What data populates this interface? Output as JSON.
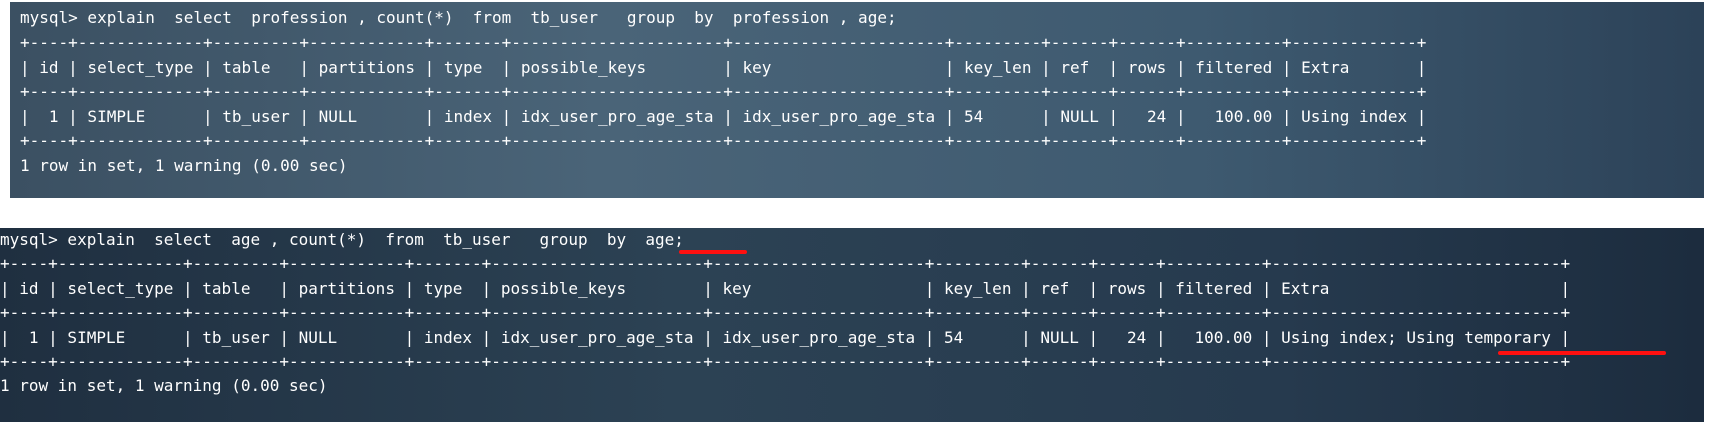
{
  "panel_1": {
    "command": "mysql> explain  select  profession , count(*)  from  tb_user   group  by  profession , age;",
    "border": "+----+-------------+---------+------------+-------+----------------------+----------------------+---------+------+------+----------+-------------+",
    "header": "| id | select_type | table   | partitions | type  | possible_keys        | key                  | key_len | ref  | rows | filtered | Extra       |",
    "row": "|  1 | SIMPLE      | tb_user | NULL       | index | idx_user_pro_age_sta | idx_user_pro_age_sta | 54      | NULL |   24 |   100.00 | Using index |",
    "footer": "1 row in set, 1 warning (0.00 sec)"
  },
  "panel_2": {
    "command": "mysql> explain  select  age , count(*)  from  tb_user   group  by  age;",
    "border": "+----+-------------+---------+------------+-------+----------------------+----------------------+---------+------+------+----------+------------------------------+",
    "header": "| id | select_type | table   | partitions | type  | possible_keys        | key                  | key_len | ref  | rows | filtered | Extra                        |",
    "row": "|  1 | SIMPLE      | tb_user | NULL       | index | idx_user_pro_age_sta | idx_user_pro_age_sta | 54      | NULL |   24 |   100.00 | Using index; Using temporary |",
    "footer": "1 row in set, 1 warning (0.00 sec)"
  },
  "colors": {
    "text": "#ffffff",
    "highlight": "#ff1010"
  }
}
